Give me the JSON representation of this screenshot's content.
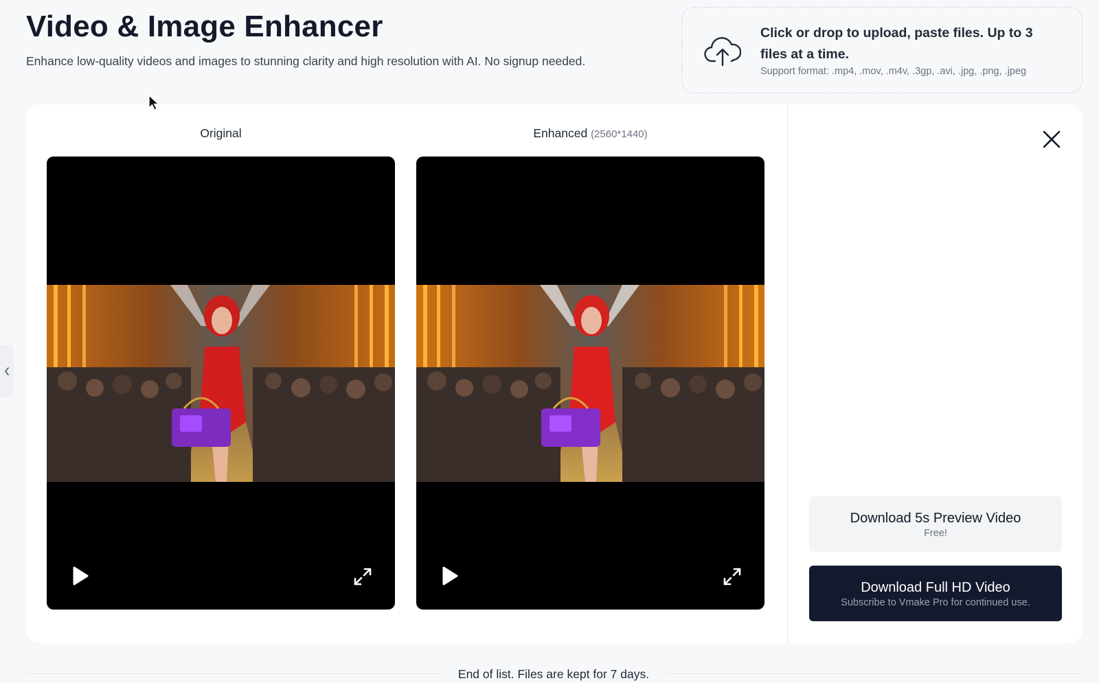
{
  "header": {
    "title": "Video & Image Enhancer",
    "subtitle": "Enhance low-quality videos and images to stunning clarity and high resolution with AI. No signup needed."
  },
  "upload": {
    "icon": "cloud-upload-icon",
    "main_text": "Click or drop to upload, paste files. Up to 3 files at a time.",
    "formats": "Support format: .mp4, .mov, .m4v, .3gp, .avi, .jpg, .png, .jpeg"
  },
  "comparison": {
    "original_label": "Original",
    "enhanced_label": "Enhanced",
    "enhanced_dimensions": "(2560*1440)"
  },
  "actions": {
    "preview": {
      "title": "Download 5s Preview Video",
      "subtitle": "Free!"
    },
    "full": {
      "title": "Download Full HD Video",
      "subtitle": "Subscribe to Vmake Pro for continued use."
    }
  },
  "footer": {
    "text": "End of list. Files are kept for 7 days."
  },
  "colors": {
    "background": "#f7f8fa",
    "card": "#ffffff",
    "primary_button": "#141a2e",
    "secondary_button": "#f3f4f6"
  }
}
